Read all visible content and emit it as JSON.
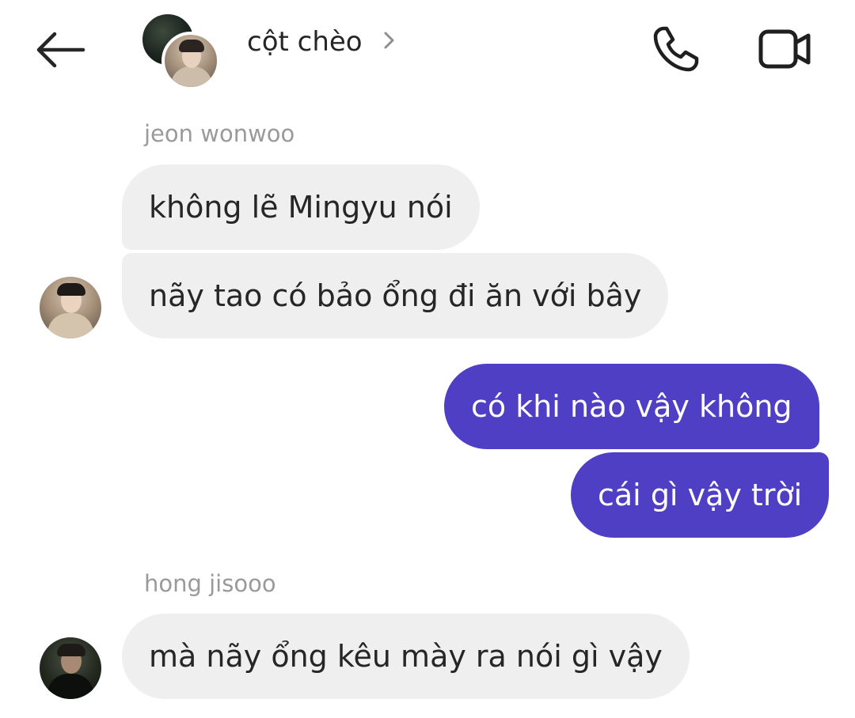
{
  "header": {
    "back_icon": "arrow-left-icon",
    "title": "cột chèo",
    "chevron_icon": "chevron-right-icon",
    "call_icon": "phone-icon",
    "video_icon": "video-camera-icon"
  },
  "colors": {
    "outgoing_bubble": "#4f3fc5",
    "incoming_bubble": "#efefef",
    "sender_label": "#9a9a9a",
    "text": "#262626"
  },
  "messages": [
    {
      "sender": "jeon wonwoo",
      "direction": "incoming",
      "text": "không lẽ Mingyu nói"
    },
    {
      "sender": "jeon wonwoo",
      "direction": "incoming",
      "text": "nãy tao có bảo ổng đi ăn với bây"
    },
    {
      "sender": "me",
      "direction": "outgoing",
      "text": "có khi nào vậy không"
    },
    {
      "sender": "me",
      "direction": "outgoing",
      "text": "cái gì vậy trời"
    },
    {
      "sender": "hong jisooo",
      "direction": "incoming",
      "text": "mà nãy ổng kêu mày ra nói gì vậy"
    }
  ]
}
